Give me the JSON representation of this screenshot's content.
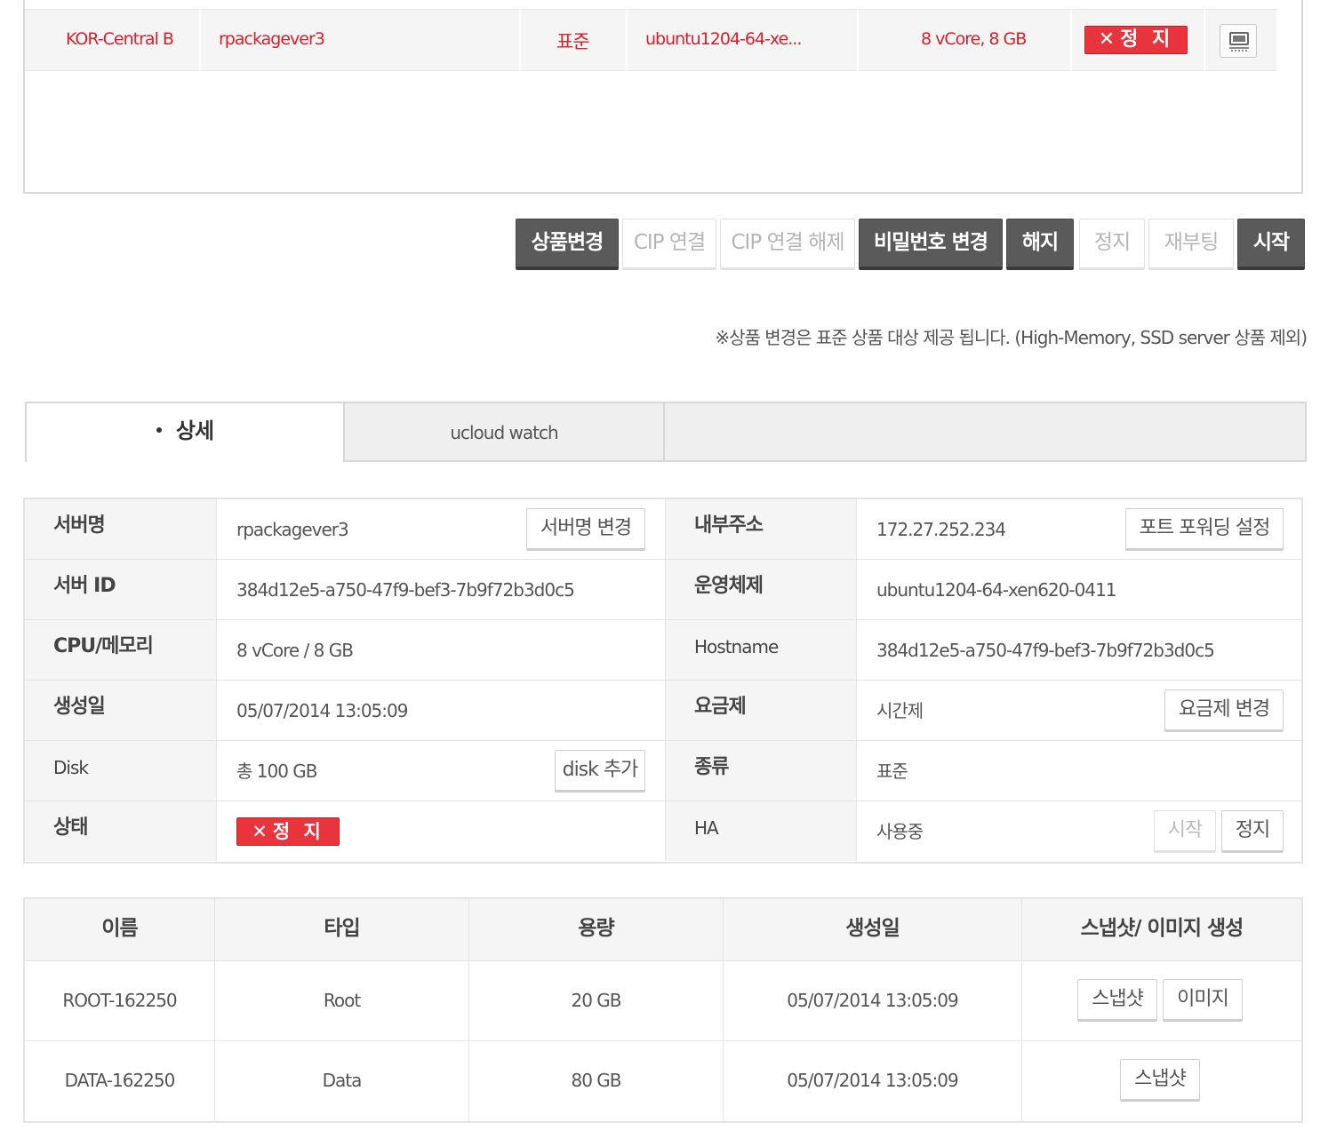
{
  "server": {
    "zone": "KOR-Central B",
    "name": "rpackagever3",
    "type": "표준",
    "image": "ubuntu1204-64-xe...",
    "spec": "8 vCore, 8 GB",
    "status_x": "✕",
    "status": "정 지",
    "console_icon": "console-icon"
  },
  "actions": {
    "change_product": "상품변경",
    "cip_connect": "CIP 연결",
    "cip_disconnect": "CIP 연결 해제",
    "change_password": "비밀번호 변경",
    "terminate": "해지",
    "stop": "정지",
    "reboot": "재부팅",
    "start": "시작"
  },
  "note": "※상품 변경은 표준 상품 대상 제공 됩니다. (High-Memory, SSD server 상품 제외)",
  "tabs": {
    "detail": "상세",
    "watch": "ucloud watch"
  },
  "detail": {
    "server_name_label": "서버명",
    "server_name": "rpackagever3",
    "server_name_btn": "서버명 변경",
    "internal_ip_label": "내부주소",
    "internal_ip": "172.27.252.234",
    "port_forward_btn": "포트 포워딩 설정",
    "server_id_label": "서버 ID",
    "server_id": "384d12e5-a750-47f9-bef3-7b9f72b3d0c5",
    "os_label": "운영체제",
    "os": "ubuntu1204-64-xen620-0411",
    "cpu_label": "CPU/메모리",
    "cpu": "8 vCore / 8 GB",
    "hostname_label": "Hostname",
    "hostname": "384d12e5-a750-47f9-bef3-7b9f72b3d0c5",
    "created_label": "생성일",
    "created": "05/07/2014 13:05:09",
    "billing_label": "요금제",
    "billing": "시간제",
    "billing_btn": "요금제 변경",
    "disk_label": "Disk",
    "disk": "총 100 GB",
    "disk_btn": "disk 추가",
    "kind_label": "종류",
    "kind": "표준",
    "status_label": "상태",
    "status_x": "✕",
    "status": "정 지",
    "ha_label": "HA",
    "ha": "사용중",
    "ha_start_btn": "시작",
    "ha_stop_btn": "정지"
  },
  "disk_table": {
    "headers": [
      "이름",
      "타입",
      "용량",
      "생성일",
      "스냅샷/ 이미지 생성"
    ],
    "rows": [
      {
        "name": "ROOT-162250",
        "type": "Root",
        "size": "20 GB",
        "created": "05/07/2014 13:05:09",
        "snapshot_btn": "스냅샷",
        "image_btn": "이미지"
      },
      {
        "name": "DATA-162250",
        "type": "Data",
        "size": "80 GB",
        "created": "05/07/2014 13:05:09",
        "snapshot_btn": "스냅샷"
      }
    ]
  }
}
